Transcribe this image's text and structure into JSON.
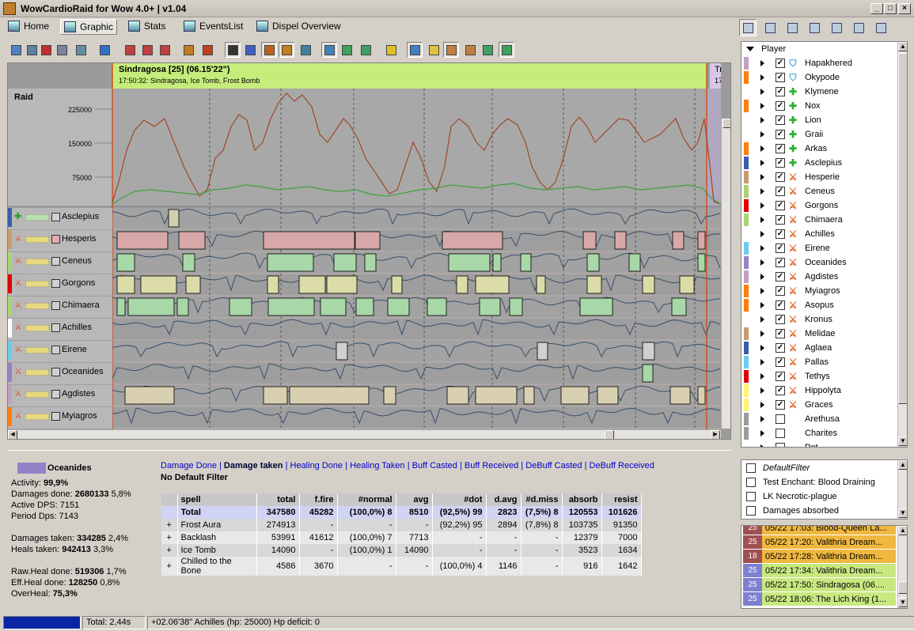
{
  "window": {
    "title": "WowCardioRaid for Wow 4.0+ | v1.04"
  },
  "tabs": [
    {
      "label": "Home",
      "active": false
    },
    {
      "label": "Graphic",
      "active": true
    },
    {
      "label": "Stats",
      "active": false
    },
    {
      "label": "EventsList",
      "active": false
    },
    {
      "label": "Dispel Overview",
      "active": false
    }
  ],
  "graph": {
    "encounter_title": "Sindragosa [25]   (06.15'22\")",
    "encounter_sub": "17:50:32: Sindragosa, Ice Tomb, Frost Bomb",
    "next_title": "Tr",
    "next_sub": "17",
    "raid_label": "Raid",
    "y_ticks": [
      "225000",
      "150000",
      "75000"
    ],
    "player_rows": [
      {
        "name": "Asclepius",
        "color": "#3a5fa8",
        "icon": "heal"
      },
      {
        "name": "Hesperis",
        "color": "#c79c6e",
        "icon": "dps"
      },
      {
        "name": "Ceneus",
        "color": "#abd473",
        "icon": "dps"
      },
      {
        "name": "Gorgons",
        "color": "#e00000",
        "icon": "dps"
      },
      {
        "name": "Chimaera",
        "color": "#abd473",
        "icon": "dps"
      },
      {
        "name": "Achilles",
        "color": "#ffffff",
        "icon": "dps"
      },
      {
        "name": "Eirene",
        "color": "#69ccf0",
        "icon": "dps"
      },
      {
        "name": "Oceanides",
        "color": "#9482c9",
        "icon": "dps"
      },
      {
        "name": "Agdistes",
        "color": "#c0a0c0",
        "icon": "dps"
      },
      {
        "name": "Myiagros",
        "color": "#ff7d0a",
        "icon": "dps"
      }
    ]
  },
  "player_panel": {
    "root_label": "Player",
    "players": [
      {
        "name": "Hapakhered",
        "color": "#c0a0c0",
        "icon": "shield",
        "checked": true
      },
      {
        "name": "Okypode",
        "color": "#ff7d0a",
        "icon": "shield",
        "checked": true
      },
      {
        "name": "Klymene",
        "color": "#ffffff",
        "icon": "heal",
        "checked": true
      },
      {
        "name": "Nox",
        "color": "#ff7d0a",
        "icon": "heal",
        "checked": true
      },
      {
        "name": "Lion",
        "color": "#ffffff",
        "icon": "heal",
        "checked": true
      },
      {
        "name": "Graii",
        "color": "#ffffff",
        "icon": "heal",
        "checked": true
      },
      {
        "name": "Arkas",
        "color": "#ff7d0a",
        "icon": "heal",
        "checked": true
      },
      {
        "name": "Asclepius",
        "color": "#3a5fa8",
        "icon": "heal",
        "checked": true
      },
      {
        "name": "Hesperie",
        "color": "#c79c6e",
        "icon": "dps",
        "checked": true
      },
      {
        "name": "Ceneus",
        "color": "#abd473",
        "icon": "dps",
        "checked": true
      },
      {
        "name": "Gorgons",
        "color": "#e00000",
        "icon": "dps",
        "checked": true
      },
      {
        "name": "Chimaera",
        "color": "#abd473",
        "icon": "dps",
        "checked": true
      },
      {
        "name": "Achilles",
        "color": "#ffffff",
        "icon": "dps",
        "checked": true
      },
      {
        "name": "Eirene",
        "color": "#69ccf0",
        "icon": "dps",
        "checked": true
      },
      {
        "name": "Oceanides",
        "color": "#9482c9",
        "icon": "dps",
        "checked": true
      },
      {
        "name": "Agdistes",
        "color": "#c0a0c0",
        "icon": "dps",
        "checked": true
      },
      {
        "name": "Myiagros",
        "color": "#ff7d0a",
        "icon": "dps",
        "checked": true
      },
      {
        "name": "Asopus",
        "color": "#ff7d0a",
        "icon": "dps",
        "checked": true
      },
      {
        "name": "Kronus",
        "color": "#ffffff",
        "icon": "dps",
        "checked": true
      },
      {
        "name": "Melidae",
        "color": "#c79c6e",
        "icon": "dps",
        "checked": true
      },
      {
        "name": "Aglaea",
        "color": "#3a5fa8",
        "icon": "dps",
        "checked": true
      },
      {
        "name": "Pallas",
        "color": "#69ccf0",
        "icon": "dps",
        "checked": true
      },
      {
        "name": "Tethys",
        "color": "#e00000",
        "icon": "dps",
        "checked": true
      },
      {
        "name": "Hippolyta",
        "color": "#fff569",
        "icon": "dps",
        "checked": true
      },
      {
        "name": "Graces",
        "color": "#fff569",
        "icon": "dps",
        "checked": true
      },
      {
        "name": "Arethusa",
        "color": "#9b9b9b",
        "icon": "",
        "checked": false
      },
      {
        "name": "Charites",
        "color": "#9b9b9b",
        "icon": "",
        "checked": false
      },
      {
        "name": "Pet",
        "color": "#ffffff",
        "icon": "",
        "checked": false
      }
    ]
  },
  "filters": [
    {
      "label": "DefaultFilter",
      "italic": true
    },
    {
      "label": "Test Enchant: Blood Draining",
      "italic": false
    },
    {
      "label": "LK Necrotic-plague",
      "italic": false
    },
    {
      "label": "Damages absorbed",
      "italic": false
    }
  ],
  "encounters": [
    {
      "num": "25",
      "text": "05/22  17:03: Blood-Queen La...",
      "numcolor": "#a05050",
      "bg": "#f0b840"
    },
    {
      "num": "25",
      "text": "05/22  17:20: Valithria Dream...",
      "numcolor": "#a05050",
      "bg": "#f0b840"
    },
    {
      "num": "18",
      "text": "05/22  17:28: Valithria Dream...",
      "numcolor": "#a05050",
      "bg": "#f0b840"
    },
    {
      "num": "25",
      "text": "05/22  17:34: Valithria Dream...",
      "numcolor": "#8080d0",
      "bg": "#c8e880"
    },
    {
      "num": "25",
      "text": "05/22  17:50: Sindragosa (06....",
      "numcolor": "#8080d0",
      "bg": "#c8e880"
    },
    {
      "num": "25",
      "text": "05/22  18:06: The Lich King (1...",
      "numcolor": "#8080d0",
      "bg": "#c8e880"
    }
  ],
  "details": {
    "player": "Oceanides",
    "player_color": "#9482c9",
    "lines": [
      {
        "label": "Activity: ",
        "value": "99,9%",
        "extra": ""
      },
      {
        "label": "Damages done: ",
        "value": "2680133",
        "extra": " 5,8%"
      },
      {
        "label": "Active DPS: ",
        "value": "",
        "extra": "7151"
      },
      {
        "label": "Period Dps: ",
        "value": "",
        "extra": "7143"
      },
      {
        "label": "Damages taken: ",
        "value": "334285",
        "extra": " 2,4%"
      },
      {
        "label": "Heals taken: ",
        "value": "942413",
        "extra": " 3,3%"
      },
      {
        "label": "Raw.Heal done: ",
        "value": "519306",
        "extra": " 1,7%"
      },
      {
        "label": "Eff.Heal done: ",
        "value": "128250",
        "extra": " 0,8%"
      },
      {
        "label": "OverHeal: ",
        "value": "75,3%",
        "extra": ""
      }
    ],
    "filter_links": [
      "Damage Done",
      "Damage taken",
      "Healing Done",
      "Healing Taken",
      "Buff Casted",
      "Buff Received",
      "DeBuff Casted",
      "DeBuff Received"
    ],
    "active_filter": "Damage taken",
    "no_default": "No Default Filter",
    "columns": [
      "",
      "spell",
      "total",
      "f.fire",
      "#normal",
      "avg",
      "#dot",
      "d.avg",
      "#d.miss",
      "absorb",
      "resist"
    ],
    "rows": [
      [
        "",
        "Total",
        "347580",
        "45282",
        "(100,0%)  8",
        "8510",
        "(92,5%)  99",
        "2823",
        "(7,5%)  8",
        "120553",
        "101626"
      ],
      [
        "+",
        "Frost Aura",
        "274913",
        "-",
        "-",
        "-",
        "(92,2%)  95",
        "2894",
        "(7,8%)  8",
        "103735",
        "91350"
      ],
      [
        "+",
        "Backlash",
        "53991",
        "41612",
        "(100,0%)  7",
        "7713",
        "-",
        "-",
        "-",
        "12379",
        "7000"
      ],
      [
        "+",
        "Ice Tomb",
        "14090",
        "-",
        "(100,0%)  1",
        "14090",
        "-",
        "-",
        "-",
        "3523",
        "1634"
      ],
      [
        "+",
        "Chilled to the Bone",
        "4586",
        "3670",
        "-",
        "-",
        "(100,0%)  4",
        "1146",
        "-",
        "916",
        "1642"
      ]
    ]
  },
  "status": {
    "total": "Total: 2,44s",
    "info": "+02.06'38\"  Achilles (hp: 25000)  Hp deficit: 0"
  }
}
